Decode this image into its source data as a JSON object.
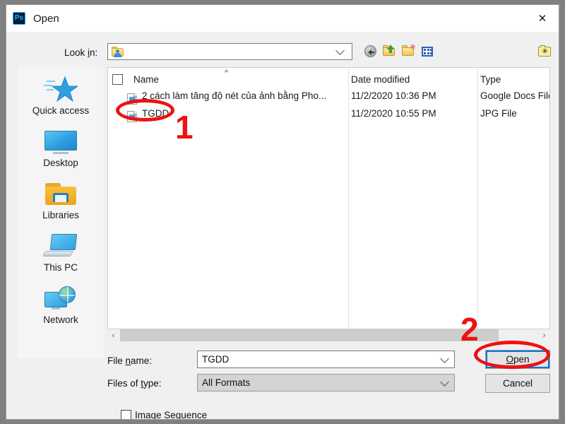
{
  "window": {
    "title": "Open",
    "app_icon": "photoshop-icon",
    "app_icon_text": "Ps",
    "close_icon": "close-icon"
  },
  "toolbar": {
    "lookin_label_pre": "Look ",
    "lookin_label_underline": "i",
    "lookin_label_post": "n:",
    "lookin_value": "",
    "buttons": [
      {
        "name": "back-button",
        "icon": "back-arrow-icon",
        "tooltip": "Back"
      },
      {
        "name": "up-one-level-button",
        "icon": "up-folder-icon",
        "tooltip": "Up One Level"
      },
      {
        "name": "new-folder-button",
        "icon": "new-folder-icon",
        "tooltip": "Create New Folder"
      },
      {
        "name": "view-menu-button",
        "icon": "view-grid-icon",
        "tooltip": "Views"
      },
      {
        "name": "adobe-dialog-button",
        "icon": "adobe-folder-star-icon",
        "tooltip": "Use Adobe Dialog"
      }
    ]
  },
  "sidebar": {
    "items": [
      {
        "label": "Quick access",
        "icon": "star-icon"
      },
      {
        "label": "Desktop",
        "icon": "monitor-icon"
      },
      {
        "label": "Libraries",
        "icon": "libraries-folder-icon"
      },
      {
        "label": "This PC",
        "icon": "computer-icon"
      },
      {
        "label": "Network",
        "icon": "network-globe-icon"
      }
    ]
  },
  "file_list": {
    "columns": [
      "Name",
      "Date modified",
      "Type"
    ],
    "sort_indicator": "^",
    "select_all_checked": false,
    "rows": [
      {
        "name": "2 cách làm tăng độ nét của ảnh bằng Pho...",
        "date_modified": "11/2/2020 10:36 PM",
        "type": "Google Docs File",
        "icon": "image-file-icon",
        "selected": false
      },
      {
        "name": "TGDD",
        "date_modified": "11/2/2020 10:55 PM",
        "type": "JPG File",
        "icon": "image-file-icon",
        "selected": true
      }
    ],
    "scrollbar": {
      "left_arrow": "‹",
      "right_arrow": "›"
    }
  },
  "form": {
    "filename_label_pre": "File ",
    "filename_label_underline": "n",
    "filename_label_post": "ame:",
    "filename_value": "TGDD",
    "filetype_label_pre": "Files of ",
    "filetype_label_underline": "t",
    "filetype_label_post": "ype:",
    "filetype_value": "All Formats",
    "image_sequence_label": "Image Sequence",
    "image_sequence_checked": false,
    "open_label_pre": "",
    "open_label_underline": "O",
    "open_label_post": "pen",
    "cancel_label": "Cancel"
  },
  "annotations": {
    "step_one": "1",
    "step_two": "2",
    "color": "#ee1111"
  }
}
